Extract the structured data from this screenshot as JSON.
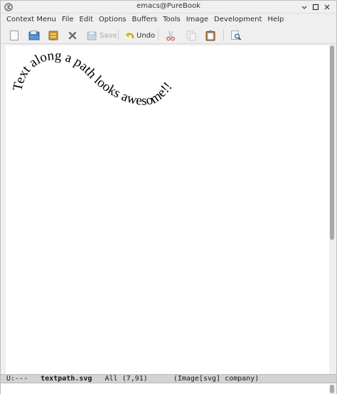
{
  "window": {
    "title": "emacs@PureBook"
  },
  "menubar": {
    "items": [
      "Context Menu",
      "File",
      "Edit",
      "Options",
      "Buffers",
      "Tools",
      "Image",
      "Development",
      "Help"
    ]
  },
  "toolbar": {
    "save_label": "Save",
    "undo_label": "Undo"
  },
  "editor": {
    "image_text": "Text along a path looks awesome!!"
  },
  "modeline": {
    "status": "U:---",
    "buffer_name": "textpath.svg",
    "position": "All (7,91)",
    "modes": "(Image[svg] company)"
  },
  "colors": {
    "window_bg": "#efefef",
    "editor_bg": "#ffffff",
    "modeline_bg": "#d3d3d3"
  },
  "icons": [
    "emacs-logo-icon",
    "new-file-icon",
    "open-folder-icon",
    "open-directory-icon",
    "close-buffer-icon",
    "save-icon",
    "undo-icon",
    "cut-icon",
    "copy-icon",
    "paste-icon",
    "search-icon"
  ]
}
